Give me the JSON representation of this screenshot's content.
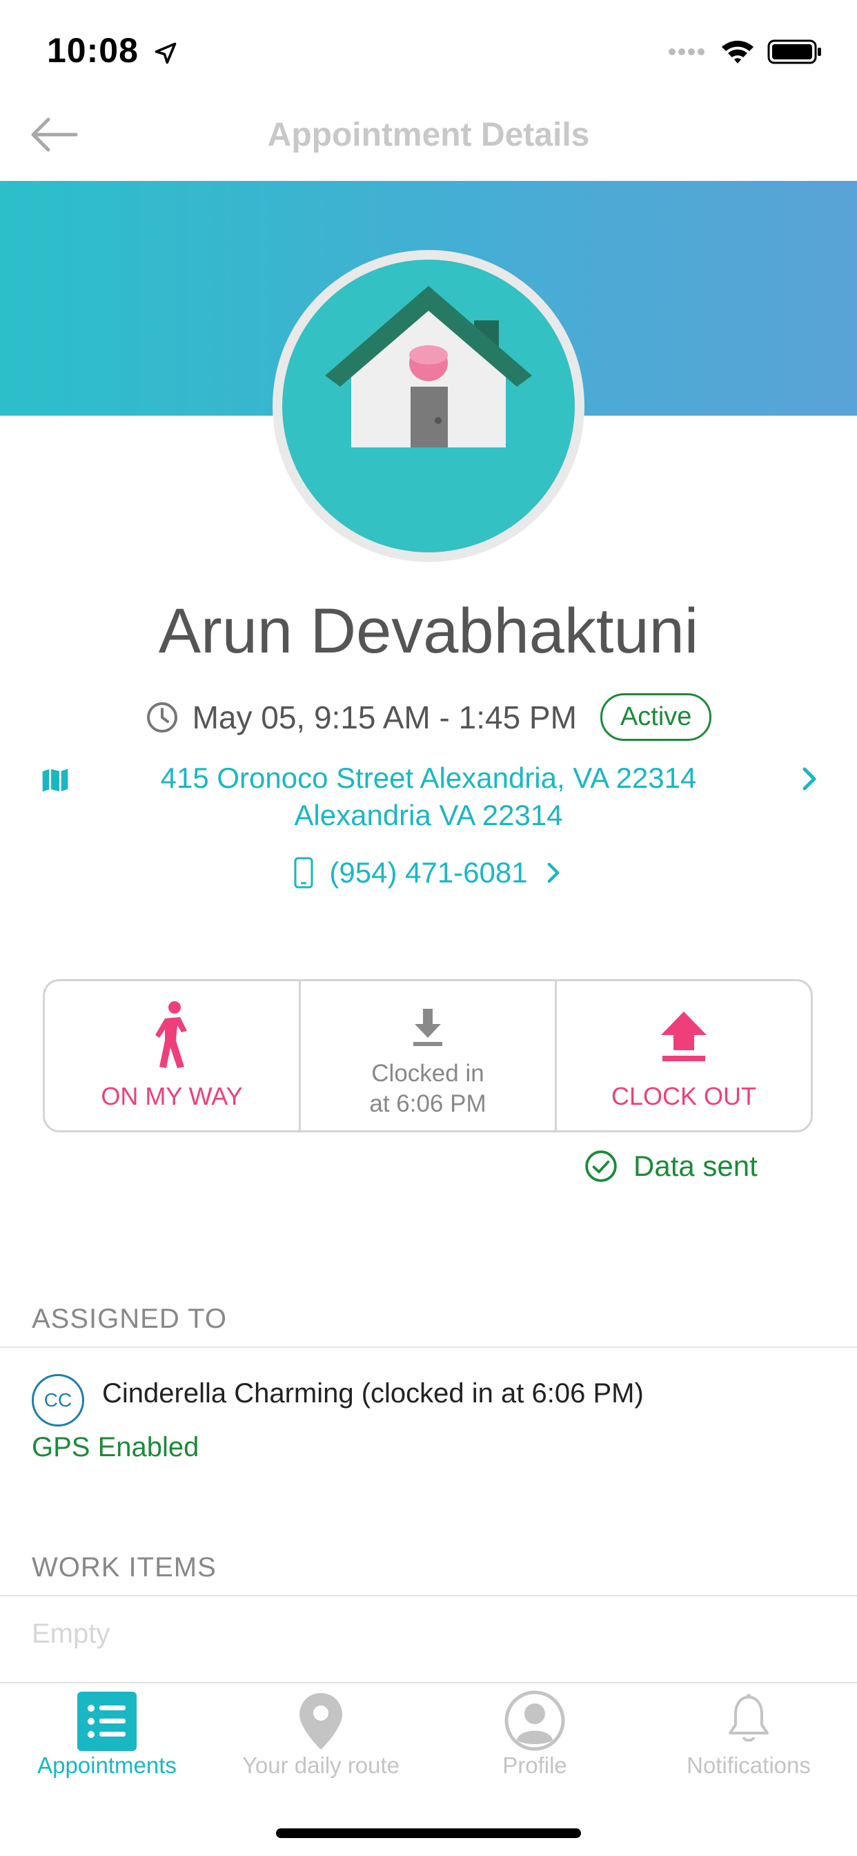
{
  "status_bar": {
    "time": "10:08"
  },
  "nav": {
    "title": "Appointment Details"
  },
  "client": {
    "name": "Arun Devabhaktuni",
    "time_range": "May 05, 9:15 AM - 1:45 PM",
    "status": "Active",
    "address_line1": "415 Oronoco Street Alexandria, VA 22314",
    "address_line2": "Alexandria VA 22314",
    "phone": "(954) 471-6081"
  },
  "actions": {
    "on_my_way": "ON MY WAY",
    "clocked_line1": "Clocked in",
    "clocked_line2": "at 6:06 PM",
    "clock_out": "CLOCK OUT",
    "data_sent": "Data sent"
  },
  "assigned": {
    "header": "ASSIGNED TO",
    "initials": "CC",
    "name": "Cinderella Charming (clocked in at 6:06 PM)",
    "gps": "GPS Enabled"
  },
  "work_items": {
    "header": "WORK ITEMS",
    "empty": "Empty"
  },
  "tabs": [
    {
      "label": "Appointments",
      "icon": "list-icon",
      "active": true
    },
    {
      "label": "Your daily route",
      "icon": "location-pin-icon",
      "active": false
    },
    {
      "label": "Profile",
      "icon": "profile-icon",
      "active": false
    },
    {
      "label": "Notifications",
      "icon": "bell-icon",
      "active": false
    }
  ],
  "colors": {
    "accent": "#19b7c4",
    "pink": "#ef3f7b",
    "green": "#1b8a3a",
    "banner_start": "#2bbfc9",
    "banner_end": "#5aa3d6"
  }
}
